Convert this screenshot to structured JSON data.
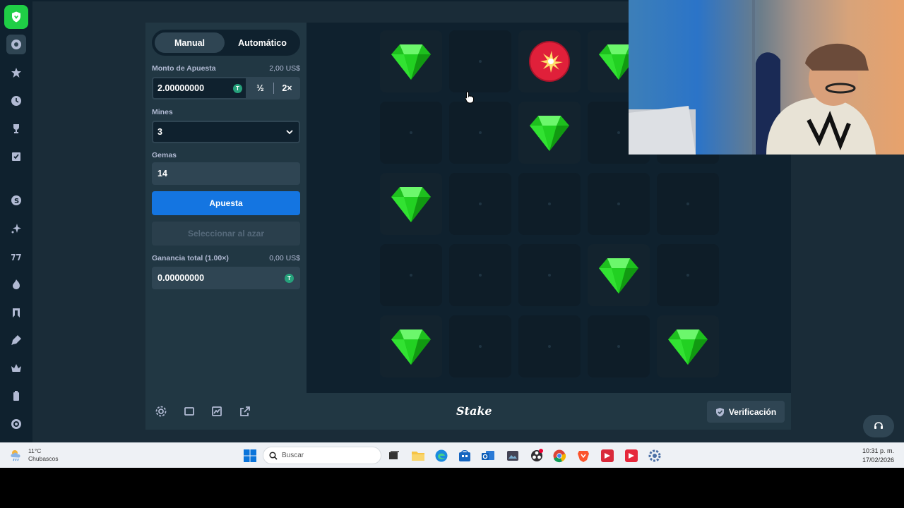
{
  "rail": {
    "logo": "stake-shield-logo",
    "items": [
      {
        "icon": "casino-chip-icon",
        "active": true
      },
      {
        "icon": "star-icon"
      },
      {
        "icon": "clock-icon"
      },
      {
        "icon": "trophy-icon"
      },
      {
        "icon": "checklist-icon"
      },
      {
        "icon": "stake-originals-icon"
      },
      {
        "icon": "sparkle-icon"
      },
      {
        "icon": "slots-icon"
      },
      {
        "icon": "fire-icon"
      },
      {
        "icon": "bookmark-icon"
      },
      {
        "icon": "pen-icon"
      },
      {
        "icon": "crown-icon"
      },
      {
        "icon": "battery-icon"
      },
      {
        "icon": "target-icon"
      }
    ]
  },
  "panel": {
    "tabs": [
      "Manual",
      "Automático"
    ],
    "active_tab": "Manual",
    "bet_label": "Monto de Apuesta",
    "bet_usd": "2,00 US$",
    "bet_value": "2.00000000",
    "half_label": "½",
    "double_label": "2×",
    "mines_label": "Mines",
    "mines_value": "3",
    "gems_label": "Gemas",
    "gems_value": "14",
    "bet_button": "Apuesta",
    "random_button": "Seleccionar al azar",
    "profit_label": "Ganancia total (1.00×)",
    "profit_usd": "0,00 US$",
    "profit_value": "0.00000000",
    "currency_letter": "T"
  },
  "board": {
    "rows": 5,
    "cols": 5,
    "grid": [
      [
        "gem",
        "hidden",
        "mine",
        "gem",
        "hidden"
      ],
      [
        "hidden",
        "hidden",
        "gem",
        "hidden",
        "hidden"
      ],
      [
        "gem",
        "hidden",
        "hidden",
        "hidden",
        "hidden"
      ],
      [
        "hidden",
        "hidden",
        "hidden",
        "gem",
        "hidden"
      ],
      [
        "gem",
        "hidden",
        "hidden",
        "hidden",
        "gem"
      ]
    ]
  },
  "footer": {
    "icons": [
      "settings-icon",
      "theater-mode-icon",
      "live-stats-icon",
      "popout-icon"
    ],
    "brand": "Stake",
    "verify_button": "Verificación"
  },
  "taskbar": {
    "temperature": "11°C",
    "weather": "Chubascos",
    "search_placeholder": "Buscar",
    "time": "10:31 p. m.",
    "date": "17/02/2026",
    "apps": [
      "windows-start-icon",
      "task-view-icon",
      "file-explorer-icon",
      "edge-icon",
      "store-icon",
      "outlook-icon",
      "camera-icon",
      "obs-icon",
      "chrome-icon",
      "brave-icon",
      "app-red-icon",
      "app-red-2-icon",
      "settings-icon"
    ]
  },
  "colors": {
    "background": "#1a2c38",
    "panel": "#213743",
    "board": "#0f212e",
    "accent_blue": "#1475e1",
    "gem_green": "#22d122",
    "mine_red": "#e0203a"
  }
}
